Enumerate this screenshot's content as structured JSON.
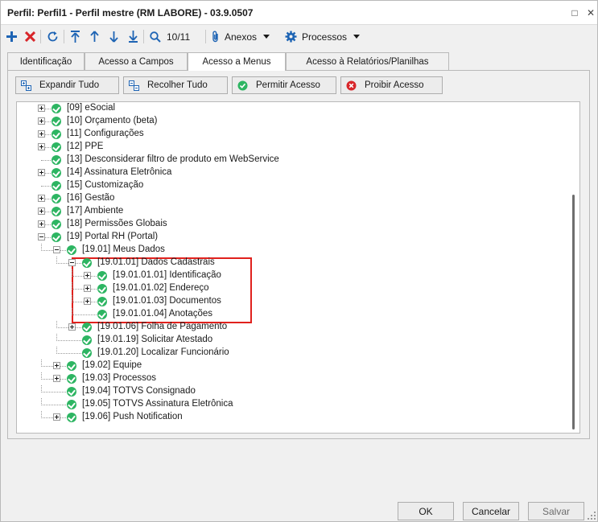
{
  "window": {
    "title": "Perfil: Perfil1 - Perfil mestre (RM LABORE) - 03.9.0507",
    "maximize_glyph": "□",
    "close_glyph": "✕"
  },
  "toolbar": {
    "counter": "10/11",
    "attachments_label": "Anexos",
    "processes_label": "Processos"
  },
  "tabs": [
    {
      "label": "Identificação",
      "active": false
    },
    {
      "label": "Acesso a Campos",
      "active": false
    },
    {
      "label": "Acesso a Menus",
      "active": true
    },
    {
      "label": "Acesso à Relatórios/Planilhas",
      "active": false
    }
  ],
  "actions": {
    "expand_all": "Expandir Tudo",
    "collapse_all": "Recolher Tudo",
    "allow_access": "Permitir Acesso",
    "deny_access": "Proibir Acesso"
  },
  "tree": {
    "items": [
      {
        "label": "[09] eSocial",
        "level": 0,
        "expander": "plus"
      },
      {
        "label": "[10] Orçamento (beta)",
        "level": 0,
        "expander": "plus"
      },
      {
        "label": "[11] Configurações",
        "level": 0,
        "expander": "plus"
      },
      {
        "label": "[12] PPE",
        "level": 0,
        "expander": "plus"
      },
      {
        "label": "[13] Desconsiderar filtro de produto em WebService",
        "level": 0,
        "expander": "none"
      },
      {
        "label": "[14] Assinatura Eletrônica",
        "level": 0,
        "expander": "plus"
      },
      {
        "label": "[15] Customização",
        "level": 0,
        "expander": "none"
      },
      {
        "label": "[16] Gestão",
        "level": 0,
        "expander": "plus"
      },
      {
        "label": "[17] Ambiente",
        "level": 0,
        "expander": "plus"
      },
      {
        "label": "[18] Permissões Globais",
        "level": 0,
        "expander": "plus"
      },
      {
        "label": "[19] Portal RH (Portal)",
        "level": 0,
        "expander": "minus"
      },
      {
        "label": "[19.01] Meus Dados",
        "level": 1,
        "expander": "minus"
      },
      {
        "label": "[19.01.01] Dados Cadastrais",
        "level": 2,
        "expander": "minus"
      },
      {
        "label": "[19.01.01.01] Identificação",
        "level": 3,
        "expander": "plus"
      },
      {
        "label": "[19.01.01.02] Endereço",
        "level": 3,
        "expander": "plus"
      },
      {
        "label": "[19.01.01.03] Documentos",
        "level": 3,
        "expander": "plus"
      },
      {
        "label": "[19.01.01.04] Anotações",
        "level": 3,
        "expander": "none"
      },
      {
        "label": "[19.01.06] Folha de Pagamento",
        "level": 2,
        "expander": "plus"
      },
      {
        "label": "[19.01.19] Solicitar Atestado",
        "level": 2,
        "expander": "none"
      },
      {
        "label": "[19.01.20] Localizar Funcionário",
        "level": 2,
        "expander": "none"
      },
      {
        "label": "[19.02] Equipe",
        "level": 1,
        "expander": "plus"
      },
      {
        "label": "[19.03] Processos",
        "level": 1,
        "expander": "plus"
      },
      {
        "label": "[19.04] TOTVS Consignado",
        "level": 1,
        "expander": "none"
      },
      {
        "label": "[19.05] TOTVS Assinatura Eletrônica",
        "level": 1,
        "expander": "none"
      },
      {
        "label": "[19.06] Push Notification",
        "level": 1,
        "expander": "plus"
      }
    ]
  },
  "footer": {
    "ok": "OK",
    "cancel": "Cancelar",
    "save": "Salvar"
  },
  "colors": {
    "accent_blue": "#1e64b4",
    "status_green": "#2db562",
    "danger_red": "#d8262a",
    "highlight_red": "#e0211d"
  }
}
